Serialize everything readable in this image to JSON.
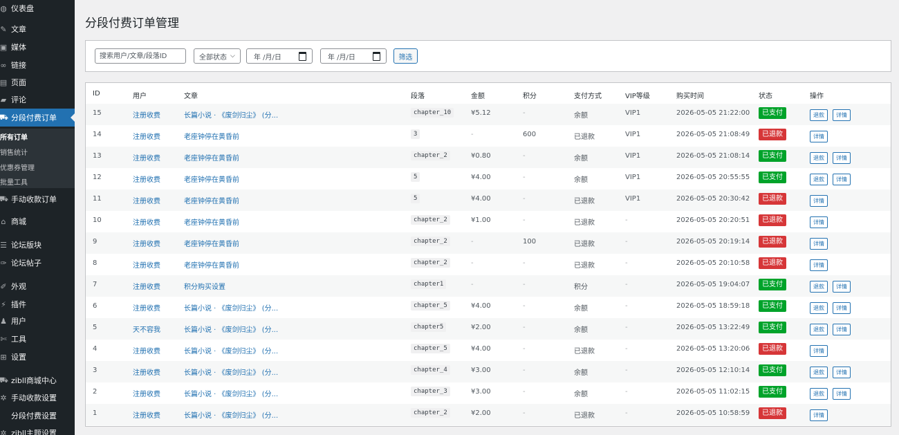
{
  "sidebar": {
    "items": [
      {
        "label": "仪表盘",
        "icon": "dashboard-icon",
        "glyph": "◍"
      },
      {
        "label": "文章",
        "icon": "pin-icon",
        "glyph": "✎"
      },
      {
        "label": "媒体",
        "icon": "media-icon",
        "glyph": "▣"
      },
      {
        "label": "链接",
        "icon": "link-icon",
        "glyph": "∞"
      },
      {
        "label": "页面",
        "icon": "page-icon",
        "glyph": "▤"
      },
      {
        "label": "评论",
        "icon": "comment-icon",
        "glyph": "▰"
      },
      {
        "label": "分段付费订单",
        "icon": "cart-icon",
        "glyph": "⛟"
      },
      {
        "label": "手动收款订单",
        "icon": "cart-icon",
        "glyph": "⛟"
      },
      {
        "label": "商城",
        "icon": "shop-icon",
        "glyph": "⌂"
      },
      {
        "label": "论坛版块",
        "icon": "forum-icon",
        "glyph": "☰"
      },
      {
        "label": "论坛帖子",
        "icon": "post-icon",
        "glyph": "✑"
      },
      {
        "label": "外观",
        "icon": "brush-icon",
        "glyph": "✐"
      },
      {
        "label": "插件",
        "icon": "plugin-icon",
        "glyph": "⚡"
      },
      {
        "label": "用户",
        "icon": "user-icon",
        "glyph": "♟"
      },
      {
        "label": "工具",
        "icon": "wrench-icon",
        "glyph": "✄"
      },
      {
        "label": "设置",
        "icon": "settings-icon",
        "glyph": "⊞"
      },
      {
        "label": "zibll商城中心",
        "icon": "cart-icon",
        "glyph": "⛟"
      },
      {
        "label": "手动收款设置",
        "icon": "gear-icon",
        "glyph": "✲"
      },
      {
        "label": "分段付费设置",
        "icon": "",
        "glyph": ""
      },
      {
        "label": "zibll主题设置",
        "icon": "gear-icon",
        "glyph": "✲"
      }
    ],
    "submenu": [
      "所有订单",
      "销售统计",
      "优惠券管理",
      "批量工具"
    ]
  },
  "page_title": "分段付费订单管理",
  "filters": {
    "search_placeholder": "搜索用户/文章/段落ID",
    "status_value": "全部状态",
    "date_start_placeholder": "年 /月/日",
    "date_end_placeholder": "年 /月/日",
    "filter_button": "筛选"
  },
  "table": {
    "columns": [
      "ID",
      "用户",
      "文章",
      "段落",
      "金额",
      "积分",
      "支付方式",
      "VIP等级",
      "购买时间",
      "状态",
      "操作"
    ],
    "actions": {
      "refund": "退款",
      "detail": "详情"
    },
    "rows": [
      {
        "id": "15",
        "user": "注册收费",
        "article": "长篇小说 · 《废剑归尘》 (分...",
        "segment": "chapter_10",
        "amount": "¥5.12",
        "points": "-",
        "payment": "余额",
        "vip": "VIP1",
        "time": "2026-05-05 21:22:00",
        "status": "已支付",
        "status_type": "paid"
      },
      {
        "id": "14",
        "user": "注册收费",
        "article": "老座钟停在黄昏前",
        "segment": "3",
        "amount": "-",
        "points": "600",
        "payment": "已退款",
        "vip": "VIP1",
        "time": "2026-05-05 21:08:49",
        "status": "已退款",
        "status_type": "refunded"
      },
      {
        "id": "13",
        "user": "注册收费",
        "article": "老座钟停在黄昏前",
        "segment": "chapter_2",
        "amount": "¥0.80",
        "points": "-",
        "payment": "余额",
        "vip": "VIP1",
        "time": "2026-05-05 21:08:14",
        "status": "已支付",
        "status_type": "paid"
      },
      {
        "id": "12",
        "user": "注册收费",
        "article": "老座钟停在黄昏前",
        "segment": "5",
        "amount": "¥4.00",
        "points": "-",
        "payment": "余额",
        "vip": "VIP1",
        "time": "2026-05-05 20:55:55",
        "status": "已支付",
        "status_type": "paid"
      },
      {
        "id": "11",
        "user": "注册收费",
        "article": "老座钟停在黄昏前",
        "segment": "5",
        "amount": "¥4.00",
        "points": "-",
        "payment": "已退款",
        "vip": "VIP1",
        "time": "2026-05-05 20:30:42",
        "status": "已退款",
        "status_type": "refunded"
      },
      {
        "id": "10",
        "user": "注册收费",
        "article": "老座钟停在黄昏前",
        "segment": "chapter_2",
        "amount": "¥1.00",
        "points": "-",
        "payment": "已退款",
        "vip": "-",
        "time": "2026-05-05 20:20:51",
        "status": "已退款",
        "status_type": "refunded"
      },
      {
        "id": "9",
        "user": "注册收费",
        "article": "老座钟停在黄昏前",
        "segment": "chapter_2",
        "amount": "-",
        "points": "100",
        "payment": "已退款",
        "vip": "-",
        "time": "2026-05-05 20:19:14",
        "status": "已退款",
        "status_type": "refunded"
      },
      {
        "id": "8",
        "user": "注册收费",
        "article": "老座钟停在黄昏前",
        "segment": "chapter_2",
        "amount": "-",
        "points": "-",
        "payment": "已退款",
        "vip": "-",
        "time": "2026-05-05 20:10:58",
        "status": "已退款",
        "status_type": "refunded"
      },
      {
        "id": "7",
        "user": "注册收费",
        "article": "积分购买设置",
        "segment": "chapter1",
        "amount": "-",
        "points": "-",
        "payment": "积分",
        "vip": "-",
        "time": "2026-05-05 19:04:07",
        "status": "已支付",
        "status_type": "paid"
      },
      {
        "id": "6",
        "user": "注册收费",
        "article": "长篇小说 · 《废剑归尘》 (分...",
        "segment": "chapter_5",
        "amount": "¥4.00",
        "points": "-",
        "payment": "余额",
        "vip": "-",
        "time": "2026-05-05 18:59:18",
        "status": "已支付",
        "status_type": "paid"
      },
      {
        "id": "5",
        "user": "天不容我",
        "article": "长篇小说 · 《废剑归尘》 (分...",
        "segment": "chapter5",
        "amount": "¥2.00",
        "points": "-",
        "payment": "余额",
        "vip": "-",
        "time": "2026-05-05 13:22:49",
        "status": "已支付",
        "status_type": "paid"
      },
      {
        "id": "4",
        "user": "注册收费",
        "article": "长篇小说 · 《废剑归尘》 (分...",
        "segment": "chapter_5",
        "amount": "¥4.00",
        "points": "-",
        "payment": "已退款",
        "vip": "-",
        "time": "2026-05-05 13:20:06",
        "status": "已退款",
        "status_type": "refunded"
      },
      {
        "id": "3",
        "user": "注册收费",
        "article": "长篇小说 · 《废剑归尘》 (分...",
        "segment": "chapter_4",
        "amount": "¥3.00",
        "points": "-",
        "payment": "余额",
        "vip": "-",
        "time": "2026-05-05 12:10:14",
        "status": "已支付",
        "status_type": "paid"
      },
      {
        "id": "2",
        "user": "注册收费",
        "article": "长篇小说 · 《废剑归尘》 (分...",
        "segment": "chapter_3",
        "amount": "¥3.00",
        "points": "-",
        "payment": "余额",
        "vip": "-",
        "time": "2026-05-05 11:02:15",
        "status": "已支付",
        "status_type": "paid"
      },
      {
        "id": "1",
        "user": "注册收费",
        "article": "长篇小说 · 《废剑归尘》 (分...",
        "segment": "chapter_2",
        "amount": "¥2.00",
        "points": "-",
        "payment": "已退款",
        "vip": "-",
        "time": "2026-05-05 10:58:59",
        "status": "已退款",
        "status_type": "refunded"
      }
    ]
  },
  "colors": {
    "accent": "#2271b1",
    "paid": "#00a32a",
    "refunded": "#d63638",
    "sidebar": "#1d2327"
  }
}
